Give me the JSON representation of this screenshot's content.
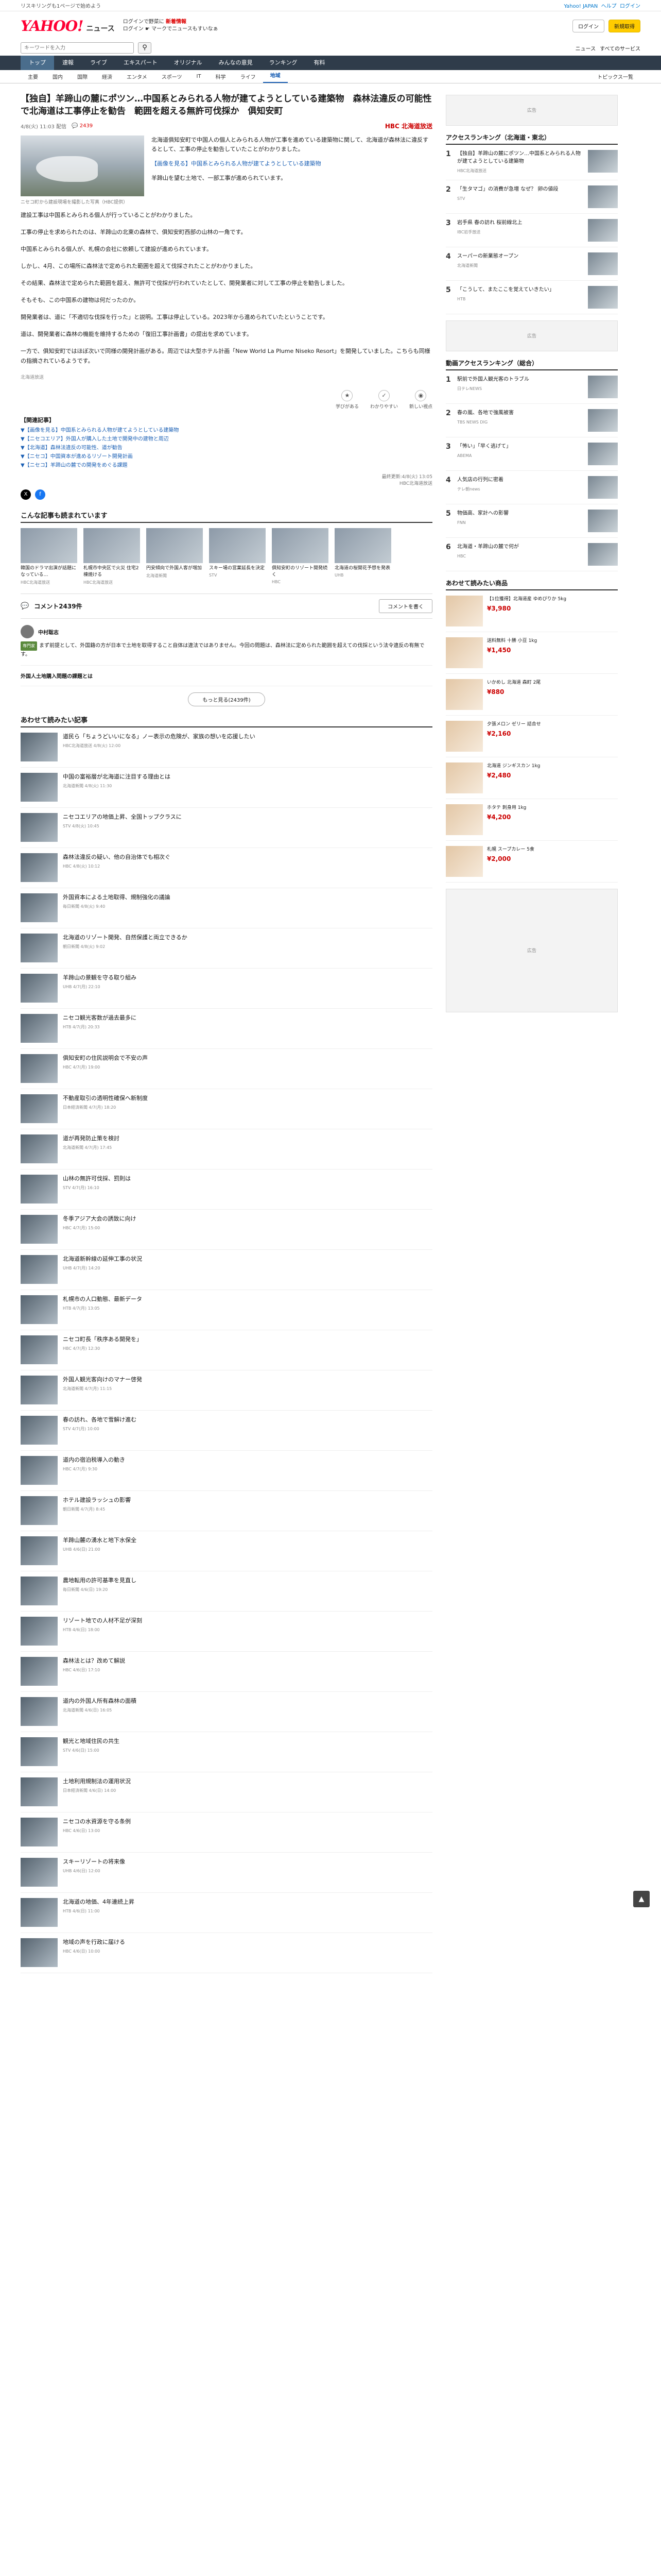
{
  "topstrip": {
    "left": "リスキリングも1ページで始めよう",
    "right_links": [
      "Yahoo! JAPAN",
      "ヘルプ",
      "ログイン"
    ]
  },
  "masthead": {
    "logo": "YAHOO!",
    "section": "ニュース",
    "promo_line1": "ログインで野菜に",
    "promo_bold": "新着情報",
    "promo_line2": "ログイン ☛ マークでニュースもすいなぁ",
    "login": "ログイン",
    "signup": "新規取得"
  },
  "search": {
    "placeholder": "キーワードを入力",
    "btn": "検索",
    "right": [
      "ニュース",
      "すべてのサービス"
    ]
  },
  "nav": [
    "トップ",
    "速報",
    "ライブ",
    "エキスパート",
    "オリジナル",
    "みんなの意見",
    "ランキング",
    "有料"
  ],
  "subnav": [
    "主要",
    "国内",
    "国際",
    "経済",
    "エンタメ",
    "スポーツ",
    "IT",
    "科学",
    "ライフ",
    "地域"
  ],
  "subnav_more": "トピックス一覧",
  "article": {
    "title": "【独自】羊蹄山の麓にポツン…中国系とみられる人物が建てようとしている建築物　森林法違反の可能性で北海道は工事停止を勧告　範囲を超える無許可伐採か　俱知安町",
    "date": "4/8(火) 11:03 配信",
    "comments": "2439",
    "provider": "HBC 北海道放送",
    "caption": "ニセコ町から建設現場を撮影した写真（HBC提供）",
    "lead_a": "北海道俱知安町で中国人の個人とみられる人物が工事を進めている建築物に関して、北海道が森林法に違反するとして、工事の停止を勧告していたことがわかりました。",
    "lead_b": "【画像を見る】中国系とみられる人物が建てようとしている建築物",
    "lead_c": "羊蹄山を望む土地で、一部工事が進められています。",
    "p1": "建設工事は中国系とみられる個人が行っていることがわかりました。",
    "p2": "工事の停止を求められたのは、羊蹄山の北東の森林で、俱知安町西部の山林の一角です。",
    "p3": "中国系とみられる個人が、札幌の会社に依頼して建設が進められています。",
    "p4": "しかし、4月、この場所に森林法で定められた範囲を超えて伐採されたことがわかりました。",
    "p5": "その結果、森林法で定められた範囲を超え、無許可で伐採が行われていたとして、開発業者に対して工事の停止を勧告しました。",
    "p6": "そもそも、この中国系の建物は何だったのか。",
    "p7": "開発業者は、道に「不適切な伐採を行った」と説明。工事は停止している。2023年から進められていたということです。",
    "p8": "道は、開発業者に森林の機能を維持するための「復旧工事計画書」の提出を求めています。",
    "p9": "一方で、俱知安町ではほぼ次いで同様の開発計画がある。周辺では大型ホテル計画「New World La Plume Niseko Resort」を開発していました。こちらも同様の指摘されているようです。",
    "p10": "北海道放送",
    "reactions": [
      "学びがある",
      "わかりやすい",
      "新しい視点"
    ],
    "related_head": "【関連記事】",
    "related": [
      "▼【画像を見る】中国系とみられる人物が建てようとしている建築物",
      "▼【ニセコエリア】外国人が購入した土地で開発中の建物と周辺",
      "▼【北海道】森林法違反の可能性、道が勧告",
      "▼【ニセコ】中国資本が進めるリゾート開発計画",
      "▼【ニセコ】羊蹄山の麓での開発をめぐる課題"
    ],
    "footmeta": "最終更新:4/8(火) 13:05",
    "footprov": "HBC北海道放送"
  },
  "cards_head": "こんな記事も読まれています",
  "cards": [
    {
      "t": "韓国のドラマ出演が話題になっている…",
      "s": "HBC北海道放送"
    },
    {
      "t": "札幌市中央区で火災 住宅2棟焼ける",
      "s": "HBC北海道放送"
    },
    {
      "t": "円安傾向で外国人客が増加",
      "s": "北海道新聞"
    },
    {
      "t": "スキー場の営業延長を決定",
      "s": "STV"
    },
    {
      "t": "俱知安町のリゾート開発続く",
      "s": "HBC"
    },
    {
      "t": "北海道の桜開花予想を発表",
      "s": "UHB"
    }
  ],
  "comments": {
    "count_label": "コメント2439件",
    "write": "コメントを書く",
    "top_name": "中村聡志",
    "top_badge": "専門家",
    "top_text": "まず前提として、外国籍の方が日本で土地を取得すること自体は違法ではありません。今回の問題は、森林法に定められた範囲を超えての伐採という法令違反の有無です。",
    "sub_title": "外国人土地購入問題の課題とは",
    "more": "もっと見る(2439件)"
  },
  "also_head": "あわせて読みたい記事",
  "also": [
    {
      "t": "道民ら「ちょうどいいになる」ノー表示の危険が、家族の想いを応援したい",
      "s": "HBC北海道放送 4/8(火) 12:00"
    },
    {
      "t": "中国の富裕層が北海道に注目する理由とは",
      "s": "北海道新聞 4/8(火) 11:30"
    },
    {
      "t": "ニセコエリアの地価上昇、全国トップクラスに",
      "s": "STV 4/8(火) 10:45"
    },
    {
      "t": "森林法違反の疑い、他の自治体でも相次ぐ",
      "s": "HBC 4/8(火) 10:12"
    },
    {
      "t": "外国資本による土地取得、規制強化の議論",
      "s": "毎日新聞 4/8(火) 9:40"
    },
    {
      "t": "北海道のリゾート開発、自然保護と両立できるか",
      "s": "朝日新聞 4/8(火) 9:02"
    },
    {
      "t": "羊蹄山の景観を守る取り組み",
      "s": "UHB 4/7(月) 22:10"
    },
    {
      "t": "ニセコ観光客数が過去最多に",
      "s": "HTB 4/7(月) 20:33"
    },
    {
      "t": "俱知安町の住民説明会で不安の声",
      "s": "HBC 4/7(月) 19:00"
    },
    {
      "t": "不動産取引の透明性確保へ新制度",
      "s": "日本経済新聞 4/7(月) 18:20"
    },
    {
      "t": "道が再発防止策を検討",
      "s": "北海道新聞 4/7(月) 17:45"
    },
    {
      "t": "山林の無許可伐採、罰則は",
      "s": "STV 4/7(月) 16:10"
    },
    {
      "t": "冬季アジア大会の誘致に向け",
      "s": "HBC 4/7(月) 15:00"
    },
    {
      "t": "北海道新幹線の延伸工事の状況",
      "s": "UHB 4/7(月) 14:20"
    },
    {
      "t": "札幌市の人口動態、最新データ",
      "s": "HTB 4/7(月) 13:05"
    },
    {
      "t": "ニセコ町長「秩序ある開発を」",
      "s": "HBC 4/7(月) 12:30"
    },
    {
      "t": "外国人観光客向けのマナー啓発",
      "s": "北海道新聞 4/7(月) 11:15"
    },
    {
      "t": "春の訪れ、各地で雪解け進む",
      "s": "STV 4/7(月) 10:00"
    },
    {
      "t": "道内の宿泊税導入の動き",
      "s": "HBC 4/7(月) 9:30"
    },
    {
      "t": "ホテル建設ラッシュの影響",
      "s": "朝日新聞 4/7(月) 8:45"
    },
    {
      "t": "羊蹄山麓の湧水と地下水保全",
      "s": "UHB 4/6(日) 21:00"
    },
    {
      "t": "農地転用の許可基準を見直し",
      "s": "毎日新聞 4/6(日) 19:20"
    },
    {
      "t": "リゾート地での人材不足が深刻",
      "s": "HTB 4/6(日) 18:00"
    },
    {
      "t": "森林法とは？改めて解説",
      "s": "HBC 4/6(日) 17:10"
    },
    {
      "t": "道内の外国人所有森林の面積",
      "s": "北海道新聞 4/6(日) 16:05"
    },
    {
      "t": "観光と地域住民の共生",
      "s": "STV 4/6(日) 15:00"
    },
    {
      "t": "土地利用規制法の運用状況",
      "s": "日本経済新聞 4/6(日) 14:00"
    },
    {
      "t": "ニセコの水資源を守る条例",
      "s": "HBC 4/6(日) 13:00"
    },
    {
      "t": "スキーリゾートの将来像",
      "s": "UHB 4/6(日) 12:00"
    },
    {
      "t": "北海道の地価、4年連続上昇",
      "s": "HTB 4/6(日) 11:00"
    },
    {
      "t": "地域の声を行政に届ける",
      "s": "HBC 4/6(日) 10:00"
    }
  ],
  "side": {
    "rank_head": "アクセスランキング（北海道・東北）",
    "ranks": [
      {
        "t": "【独自】羊蹄山の麓にポツン…中国系とみられる人物が建てようとしている建築物",
        "s": "HBC北海道放送"
      },
      {
        "t": "「生タマゴ」の消費が急増 なぜ？ 卵の値段",
        "s": "STV"
      },
      {
        "t": "岩手県 春の訪れ 桜前線北上",
        "s": "IBC岩手放送"
      },
      {
        "t": "スーパーの新業態オープン",
        "s": "北海道新聞"
      },
      {
        "t": "「こうして、またここを覚えていきたい」",
        "s": "HTB"
      }
    ],
    "dom_head": "動画アクセスランキング（総合）",
    "doms": [
      {
        "t": "駅前で外国人観光客のトラブル",
        "s": "日テレNEWS"
      },
      {
        "t": "春の嵐、各地で強風被害",
        "s": "TBS NEWS DIG"
      },
      {
        "t": "「怖い」「早く逃げて」",
        "s": "ABEMA"
      },
      {
        "t": "人気店の行列に密着",
        "s": "テレ朝news"
      },
      {
        "t": "物価高、家計への影響",
        "s": "FNN"
      },
      {
        "t": "北海道・羊蹄山の麓で何が",
        "s": "HBC"
      }
    ],
    "shop_head": "あわせて読みたい商品",
    "prods": [
      {
        "t": "【1位獲得】北海道産 ゆめぴりか 5kg",
        "p": "¥3,980"
      },
      {
        "t": "送料無料 十勝 小豆 1kg",
        "p": "¥1,450"
      },
      {
        "t": "いかめし 北海道 森町 2尾",
        "p": "¥880"
      },
      {
        "t": "夕張メロン ゼリー 詰合せ",
        "p": "¥2,160"
      },
      {
        "t": "北海道 ジンギスカン 1kg",
        "p": "¥2,480"
      },
      {
        "t": "ホタテ 刺身用 1kg",
        "p": "¥4,200"
      },
      {
        "t": "札幌 スープカレー 5食",
        "p": "¥2,000"
      }
    ],
    "ad": "広告"
  }
}
